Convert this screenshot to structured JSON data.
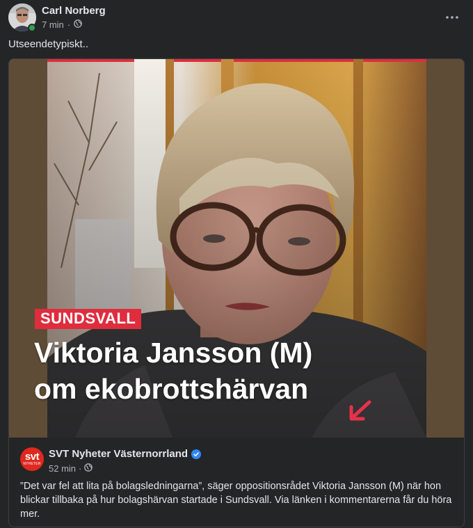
{
  "post": {
    "author": "Carl Norberg",
    "time": "7 min",
    "separator": "·",
    "text": "Utseendetypiskt.."
  },
  "icons": {
    "more": "more-horizontal-icon",
    "audience": "globe-icon",
    "verified": "verified-badge-icon",
    "arrow": "red-arrow-icon"
  },
  "shared": {
    "overlay_tag": "SUNDSVALL",
    "headline_line1": "Viktoria Jansson (M)",
    "headline_line2": "om ekobrottshärvan",
    "source_logo_word": "svt",
    "source_logo_sub": "NYHETER",
    "source_name": "SVT Nyheter Västernorrland",
    "source_time": "52 min",
    "source_text": "”Det var fel att lita på bolagsledningarna”, säger oppositionsrådet Viktoria Jansson (M) när hon blickar tillbaka på hur bolagshärvan startade i Sundsvall. Via länken i kommentarerna får du höra mer."
  },
  "colors": {
    "background": "#242526",
    "text_primary": "#e4e6eb",
    "text_secondary": "#b0b3b8",
    "online": "#31a24c",
    "tag_red": "#df2d3e",
    "svt_red": "#e0281f",
    "verified_blue": "#2d88ff"
  }
}
